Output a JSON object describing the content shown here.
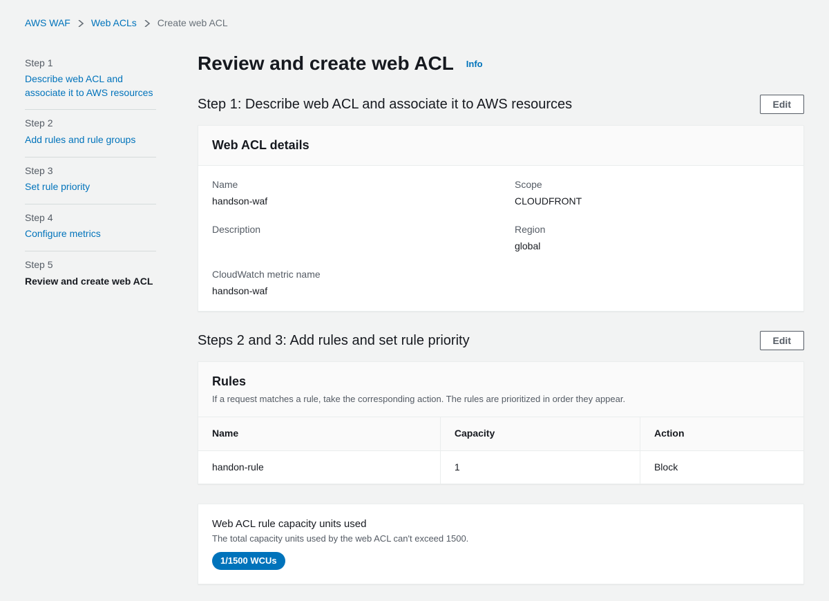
{
  "breadcrumb": {
    "items": [
      {
        "label": "AWS WAF",
        "link": true
      },
      {
        "label": "Web ACLs",
        "link": true
      },
      {
        "label": "Create web ACL",
        "link": false
      }
    ]
  },
  "sidebar": {
    "steps": [
      {
        "num": "Step 1",
        "label": "Describe web ACL and associate it to AWS resources",
        "active": false
      },
      {
        "num": "Step 2",
        "label": "Add rules and rule groups",
        "active": false
      },
      {
        "num": "Step 3",
        "label": "Set rule priority",
        "active": false
      },
      {
        "num": "Step 4",
        "label": "Configure metrics",
        "active": false
      },
      {
        "num": "Step 5",
        "label": "Review and create web ACL",
        "active": true
      }
    ]
  },
  "main": {
    "title": "Review and create web ACL",
    "info_label": "Info",
    "section1": {
      "heading": "Step 1: Describe web ACL and associate it to AWS resources",
      "edit_label": "Edit",
      "card_title": "Web ACL details",
      "kv": {
        "name_label": "Name",
        "name_value": "handson-waf",
        "scope_label": "Scope",
        "scope_value": "CLOUDFRONT",
        "description_label": "Description",
        "description_value": "",
        "region_label": "Region",
        "region_value": "global",
        "metric_label": "CloudWatch metric name",
        "metric_value": "handson-waf"
      }
    },
    "section2": {
      "heading": "Steps 2 and 3: Add rules and set rule priority",
      "edit_label": "Edit",
      "card_title": "Rules",
      "card_subtitle": "If a request matches a rule, take the corresponding action. The rules are prioritized in order they appear.",
      "columns": {
        "name": "Name",
        "capacity": "Capacity",
        "action": "Action"
      },
      "rows": [
        {
          "name": "handon-rule",
          "capacity": "1",
          "action": "Block"
        }
      ]
    },
    "capacity": {
      "title": "Web ACL rule capacity units used",
      "desc": "The total capacity units used by the web ACL can't exceed 1500.",
      "badge": "1/1500 WCUs"
    }
  }
}
